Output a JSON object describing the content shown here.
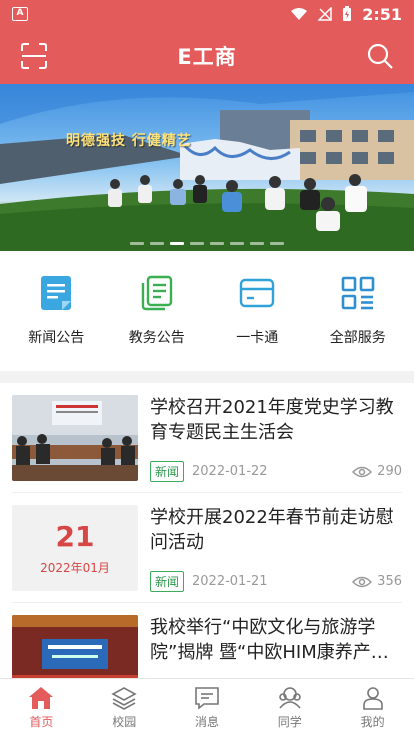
{
  "status_bar": {
    "time": "2:51",
    "app_icon_letter": "A"
  },
  "header": {
    "title": "E工商"
  },
  "banner": {
    "slogan": "明德强技  行健精艺",
    "slide_count": 8,
    "active_index": 2
  },
  "quick_nav": [
    {
      "label": "新闻公告",
      "icon": "news-icon",
      "color": "#2f9bd6"
    },
    {
      "label": "教务公告",
      "icon": "academic-notice-icon",
      "color": "#3cae52"
    },
    {
      "label": "一卡通",
      "icon": "card-icon",
      "color": "#2fa3d8"
    },
    {
      "label": "全部服务",
      "icon": "grid-icon",
      "color": "#2f8fd0"
    }
  ],
  "news": [
    {
      "title": "学校召开2021年度党史学习教育专题民主生活会",
      "tag": "新闻",
      "date": "2022-01-22",
      "views": "290"
    },
    {
      "title": "学校开展2022年春节前走访慰问活动",
      "tag": "新闻",
      "date": "2022-01-21",
      "views": "356",
      "thumb_day": "21",
      "thumb_month": "2022年01月"
    },
    {
      "title": "我校举行“中欧文化与旅游学院”揭牌 暨“中欧HIM康养产…"
    }
  ],
  "tabs": [
    {
      "label": "首页",
      "icon": "home-icon"
    },
    {
      "label": "校园",
      "icon": "campus-layers-icon"
    },
    {
      "label": "消息",
      "icon": "message-icon"
    },
    {
      "label": "同学",
      "icon": "classmates-icon"
    },
    {
      "label": "我的",
      "icon": "profile-icon"
    }
  ],
  "colors": {
    "brand": "#e35b5a",
    "tag_green": "#2e9a4e"
  }
}
